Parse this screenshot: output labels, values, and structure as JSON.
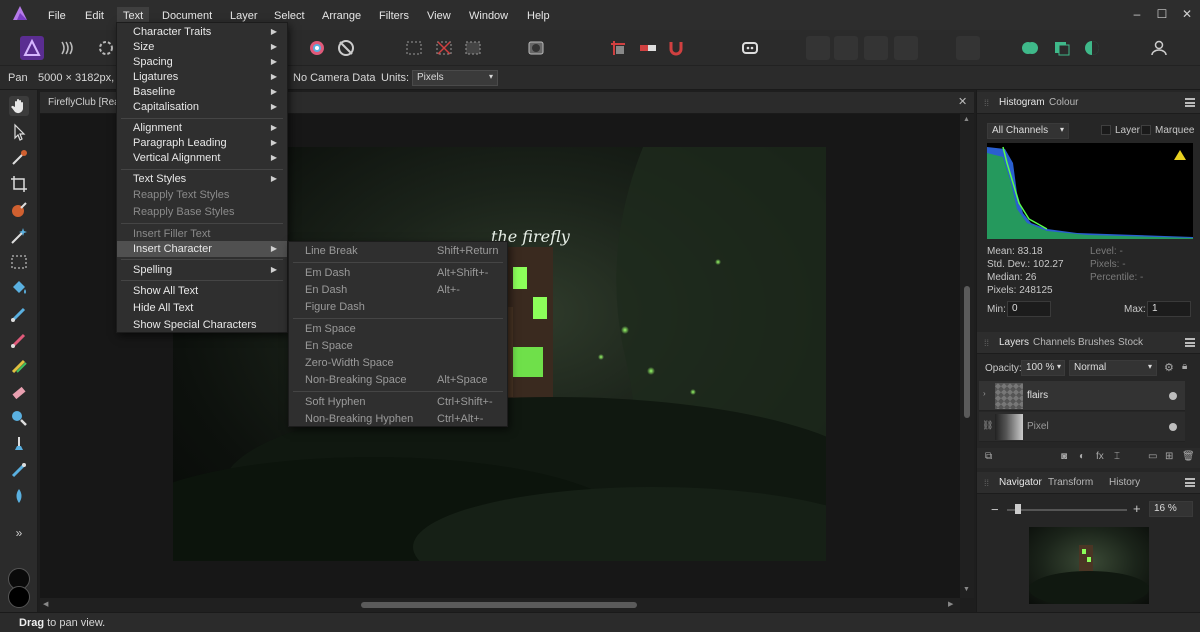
{
  "menubar": {
    "items": [
      "File",
      "Edit",
      "Text",
      "Document",
      "Layer",
      "Select",
      "Arrange",
      "Filters",
      "View",
      "Window",
      "Help"
    ],
    "active": "Text"
  },
  "contextbar": {
    "tool": "Pan",
    "doc_info": "5000 × 3182px, 1",
    "camera": "No Camera Data",
    "units_label": "Units:",
    "units_value": "Pixels"
  },
  "document": {
    "tab_title": "FireflyClub [Read"
  },
  "text_menu": {
    "items": [
      {
        "label": "Character Traits",
        "sub": true,
        "disabled": false
      },
      {
        "label": "Size",
        "sub": true,
        "disabled": false
      },
      {
        "label": "Spacing",
        "sub": true,
        "disabled": false
      },
      {
        "label": "Ligatures",
        "sub": true,
        "disabled": false
      },
      {
        "label": "Baseline",
        "sub": true,
        "disabled": false
      },
      {
        "label": "Capitalisation",
        "sub": true,
        "disabled": false
      },
      {
        "label": "Alignment",
        "sub": true,
        "disabled": false
      },
      {
        "label": "Paragraph Leading",
        "sub": true,
        "disabled": false
      },
      {
        "label": "Vertical Alignment",
        "sub": true,
        "disabled": false
      },
      {
        "label": "Text Styles",
        "sub": true,
        "disabled": false
      },
      {
        "label": "Reapply Text Styles",
        "sub": false,
        "disabled": true
      },
      {
        "label": "Reapply Base Styles",
        "sub": false,
        "disabled": true
      },
      {
        "label": "Insert Filler Text",
        "sub": false,
        "disabled": true
      },
      {
        "label": "Insert Character",
        "sub": true,
        "disabled": false
      },
      {
        "label": "Spelling",
        "sub": true,
        "disabled": false
      },
      {
        "label": "Show All Text",
        "sub": false,
        "disabled": false
      },
      {
        "label": "Hide All Text",
        "sub": false,
        "disabled": false
      },
      {
        "label": "Show Special Characters",
        "sub": false,
        "disabled": false
      }
    ]
  },
  "insert_character_menu": {
    "items": [
      {
        "label": "Line Break",
        "shortcut": "Shift+Return"
      },
      {
        "label": "Em Dash",
        "shortcut": "Alt+Shift+-"
      },
      {
        "label": "En Dash",
        "shortcut": "Alt+-"
      },
      {
        "label": "Figure Dash",
        "shortcut": ""
      },
      {
        "label": "Em Space",
        "shortcut": ""
      },
      {
        "label": "En Space",
        "shortcut": ""
      },
      {
        "label": "Zero-Width Space",
        "shortcut": ""
      },
      {
        "label": "Non-Breaking Space",
        "shortcut": "Alt+Space"
      },
      {
        "label": "Soft Hyphen",
        "shortcut": "Ctrl+Shift+-"
      },
      {
        "label": "Non-Breaking Hyphen",
        "shortcut": "Ctrl+Alt+-"
      }
    ]
  },
  "histogram": {
    "tabs": [
      "Histogram",
      "Colour"
    ],
    "channel": "All Channels",
    "layer_label": "Layer",
    "marquee_label": "Marquee",
    "mean": "Mean: 83.18",
    "std": "Std. Dev.: 102.27",
    "median": "Median: 26",
    "pixels": "Pixels: 248125",
    "level": "Level: -",
    "pixels_r": "Pixels: -",
    "percentile": "Percentile: -",
    "min_label": "Min:",
    "min_value": "0",
    "max_label": "Max:",
    "max_value": "1"
  },
  "layers": {
    "tabs": [
      "Layers",
      "Channels",
      "Brushes",
      "Stock"
    ],
    "opacity_label": "Opacity:",
    "opacity_value": "100 %",
    "blend_mode": "Normal",
    "rows": [
      {
        "name": "flairs"
      },
      {
        "name": "Pixel"
      }
    ]
  },
  "navigator": {
    "tabs": [
      "Navigator",
      "Transform",
      "History"
    ],
    "zoom": "16 %"
  },
  "status": {
    "bold": "Drag",
    "text": " to pan view."
  },
  "artwork": {
    "sign_text": "the firefly"
  },
  "colors": {
    "accent": "#7b3fbf",
    "highlight": "#505050"
  }
}
